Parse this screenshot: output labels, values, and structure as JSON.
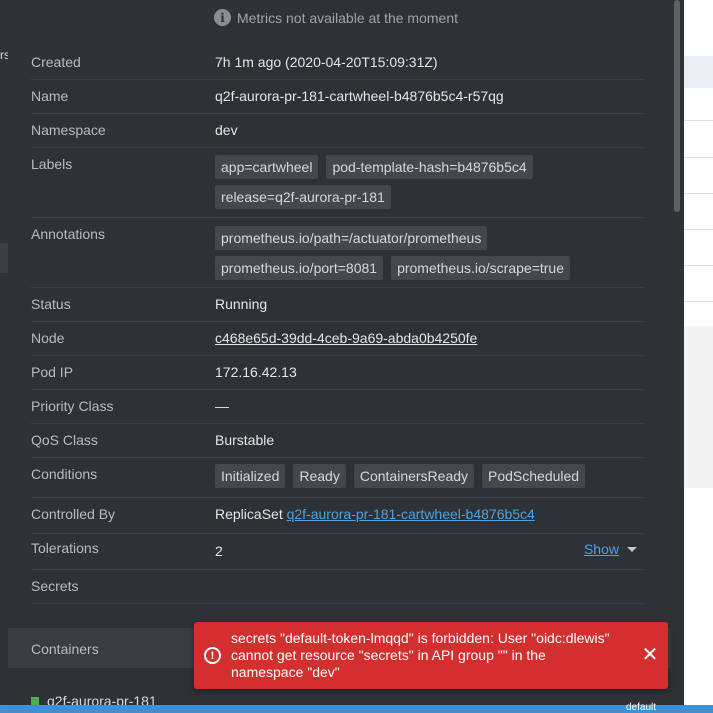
{
  "background": {
    "left_fragment": "rs",
    "namespace_label": "default"
  },
  "metrics_message": "Metrics not available at the moment",
  "details": {
    "created": {
      "label": "Created",
      "value": "7h 1m ago (2020-04-20T15:09:31Z)"
    },
    "name": {
      "label": "Name",
      "value": "q2f-aurora-pr-181-cartwheel-b4876b5c4-r57qg"
    },
    "namespace": {
      "label": "Namespace",
      "value": "dev"
    },
    "labels": {
      "label": "Labels",
      "chips": [
        "app=cartwheel",
        "pod-template-hash=b4876b5c4",
        "release=q2f-aurora-pr-181"
      ]
    },
    "annotations": {
      "label": "Annotations",
      "chips": [
        "prometheus.io/path=/actuator/prometheus",
        "prometheus.io/port=8081",
        "prometheus.io/scrape=true"
      ]
    },
    "status": {
      "label": "Status",
      "value": "Running"
    },
    "node": {
      "label": "Node",
      "value": "c468e65d-39dd-4ceb-9a69-abda0b4250fe"
    },
    "pod_ip": {
      "label": "Pod IP",
      "value": "172.16.42.13"
    },
    "priority_class": {
      "label": "Priority Class",
      "value": "—"
    },
    "qos_class": {
      "label": "QoS Class",
      "value": "Burstable"
    },
    "conditions": {
      "label": "Conditions",
      "chips": [
        "Initialized",
        "Ready",
        "ContainersReady",
        "PodScheduled"
      ]
    },
    "controlled_by": {
      "label": "Controlled By",
      "kind": "ReplicaSet",
      "link": "q2f-aurora-pr-181-cartwheel-b4876b5c4"
    },
    "tolerations": {
      "label": "Tolerations",
      "value": "2",
      "show_label": "Show"
    },
    "secrets": {
      "label": "Secrets"
    }
  },
  "containers": {
    "title": "Containers",
    "first_item": "q2f-aurora-pr-181"
  },
  "toast": {
    "message": "secrets \"default-token-lmqqd\" is forbidden: User \"oidc:dlewis\" cannot get resource \"secrets\" in API group \"\" in the namespace \"dev\"",
    "close_symbol": "✕"
  },
  "colors": {
    "drawer_bg": "#2e3136",
    "running": "#4caf50",
    "link": "#4ba3e3",
    "toast": "#d32f2f",
    "accent_bar": "#3d8fd6"
  }
}
